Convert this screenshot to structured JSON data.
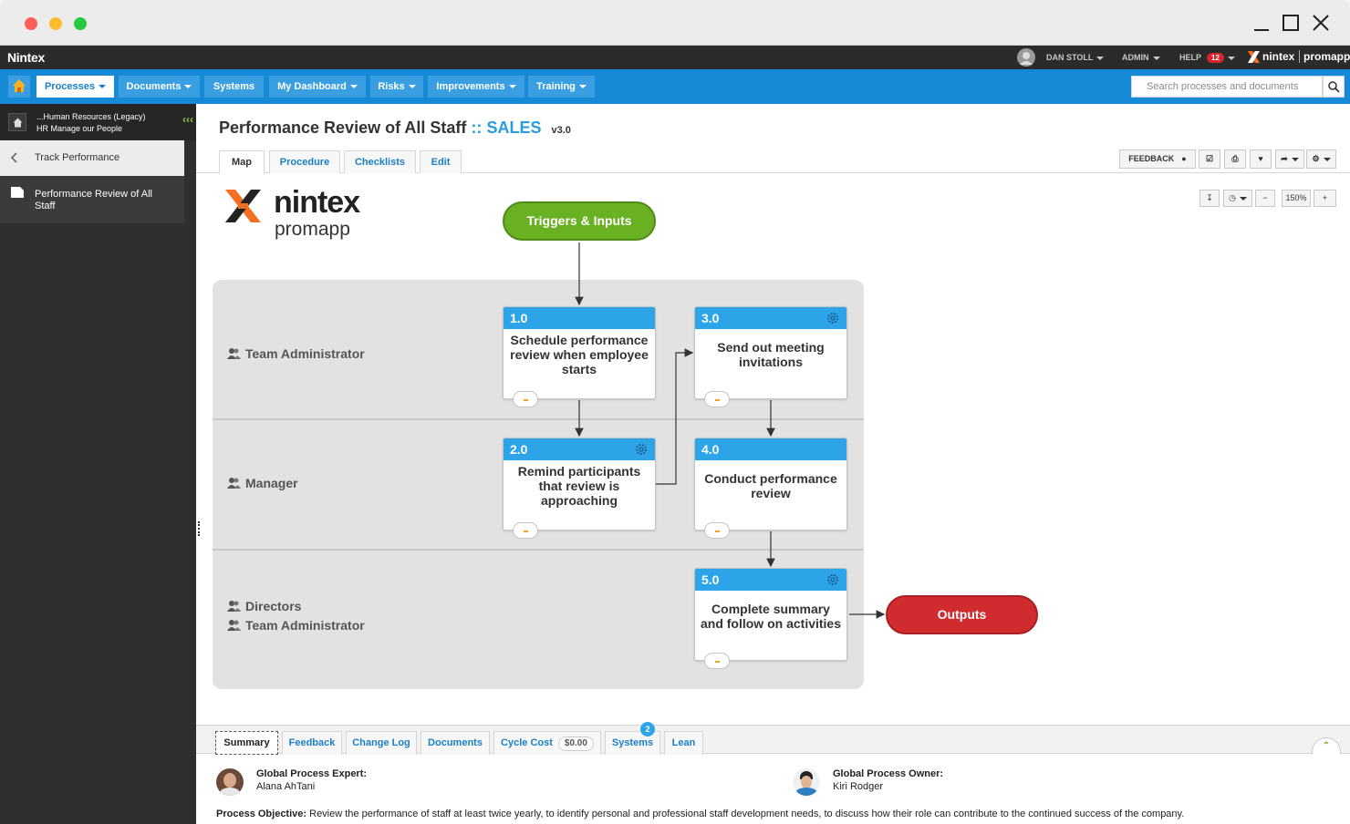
{
  "app": {
    "brand": "Nintex"
  },
  "user": {
    "name": "DAN STOLL",
    "admin": "ADMIN",
    "help": "HELP",
    "help_count": "12",
    "logo_left": "nintex",
    "logo_right": "promapp"
  },
  "nav": {
    "home": "home-icon",
    "items": [
      {
        "label": "Processes",
        "active": true,
        "caret": true
      },
      {
        "label": "Documents",
        "caret": true
      },
      {
        "label": "Systems",
        "caret": false
      },
      {
        "label": "My Dashboard",
        "caret": true
      },
      {
        "label": "Risks",
        "caret": true
      },
      {
        "label": "Improvements",
        "caret": true
      },
      {
        "label": "Training",
        "caret": true
      }
    ],
    "search_placeholder": "Search processes and documents"
  },
  "sidebar": {
    "group_line1": "...Human Resources (Legacy)",
    "group_line2": "HR Manage our People",
    "back_label": "Track Performance",
    "current_label_1": "Performance Review of All",
    "current_label_2": "Staff"
  },
  "page": {
    "title": "Performance Review of All Staff",
    "separator": "::",
    "group": "SALES",
    "version": "v3.0",
    "tabs": [
      "Map",
      "Procedure",
      "Checklists",
      "Edit"
    ],
    "feedback_btn": "FEEDBACK",
    "zoom": "150%"
  },
  "map": {
    "logo_word": "nintex",
    "logo_sub": "promapp",
    "trigger": "Triggers & Inputs",
    "output": "Outputs",
    "roles": {
      "lane1": "Team Administrator",
      "lane2": "Manager",
      "lane3a": "Directors",
      "lane3b": "Team Administrator"
    },
    "steps": {
      "s1": {
        "num": "1.0",
        "text": "Schedule performance review when employee starts"
      },
      "s2": {
        "num": "2.0",
        "text": "Remind participants that review is approaching"
      },
      "s3": {
        "num": "3.0",
        "text": "Send out meeting invitations"
      },
      "s4": {
        "num": "4.0",
        "text": "Conduct performance review"
      },
      "s5": {
        "num": "5.0",
        "text": "Complete summary and follow on activities"
      }
    }
  },
  "bottom": {
    "tabs": {
      "summary": "Summary",
      "feedback": "Feedback",
      "changelog": "Change Log",
      "documents": "Documents",
      "cyclecost": "Cycle Cost",
      "cyclecost_value": "$0.00",
      "systems": "Systems",
      "systems_badge": "2",
      "lean": "Lean"
    },
    "expert_label": "Global Process Expert:",
    "expert_name": "Alana AhTani",
    "owner_label": "Global Process Owner:",
    "owner_name": "Kiri Rodger",
    "objective_label": "Process Objective:",
    "objective_text": "Review the performance of staff at least twice yearly, to identify personal and professional staff development needs, to discuss how their role can contribute to the continued success of the company."
  },
  "colors": {
    "accent": "#168ad6",
    "step_header": "#2ea4e8",
    "trigger": "#6ab023",
    "output": "#d02c30"
  }
}
